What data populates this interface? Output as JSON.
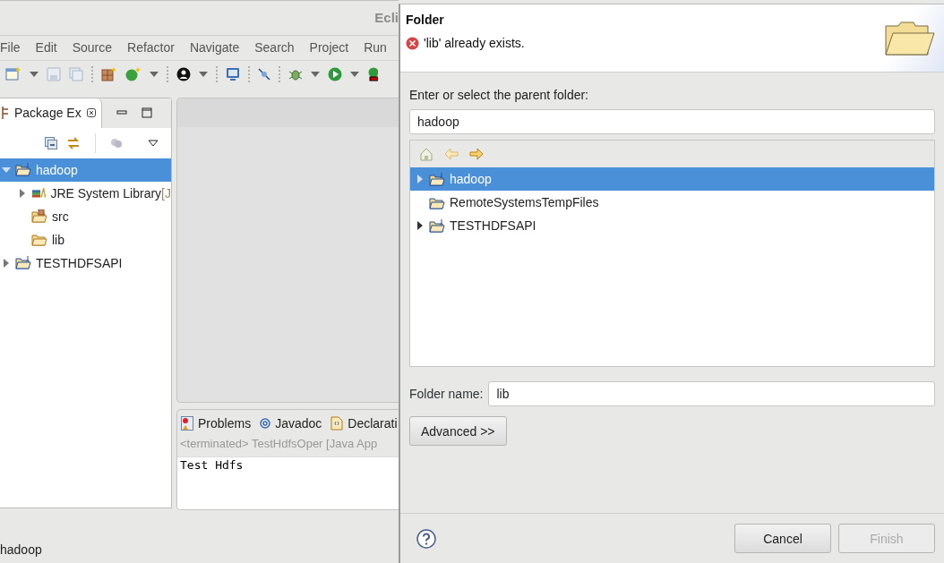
{
  "eclipse": {
    "title": "Ecli",
    "menu": [
      {
        "label": "File"
      },
      {
        "label": "Edit"
      },
      {
        "label": "Source"
      },
      {
        "label": "Refactor"
      },
      {
        "label": "Navigate"
      },
      {
        "label": "Search"
      },
      {
        "label": "Project"
      },
      {
        "label": "Run"
      }
    ],
    "package_explorer": {
      "tab": "Package Ex",
      "tree": [
        {
          "label": "hadoop",
          "kind": "project",
          "expanded": true,
          "selected": true,
          "children": [
            {
              "label": "JRE System Library",
              "suffix": "[J",
              "kind": "library",
              "expanded": false,
              "selected": false
            },
            {
              "label": "src",
              "kind": "package",
              "selected": false
            },
            {
              "label": "lib",
              "kind": "folder",
              "selected": false
            }
          ]
        },
        {
          "label": "TESTHDFSAPI",
          "kind": "project",
          "expanded": false,
          "selected": false
        }
      ]
    },
    "console": {
      "tabs": [
        {
          "label": "Problems",
          "kind": "problems"
        },
        {
          "label": "Javadoc",
          "kind": "javadoc"
        },
        {
          "label": "Declarati",
          "kind": "declaration"
        }
      ],
      "header": "<terminated> TestHdfsOper [Java App",
      "output": "Test Hdfs"
    },
    "status_bar": "hadoop"
  },
  "dialog": {
    "title": "Folder",
    "error": "'lib' already exists.",
    "parent_label": "Enter or select the parent folder:",
    "parent_value": "hadoop",
    "folders": [
      {
        "label": "hadoop",
        "kind": "project",
        "expanded": false,
        "selected": true
      },
      {
        "label": "RemoteSystemsTempFiles",
        "kind": "folder",
        "selected": false
      },
      {
        "label": "TESTHDFSAPI",
        "kind": "project",
        "expanded": false,
        "selected": false
      }
    ],
    "folder_name_label": "Folder name:",
    "folder_name": "lib",
    "advanced": "Advanced >>",
    "buttons": [
      {
        "label": "Cancel",
        "disabled": false
      },
      {
        "label": "Finish",
        "disabled": true
      }
    ]
  }
}
